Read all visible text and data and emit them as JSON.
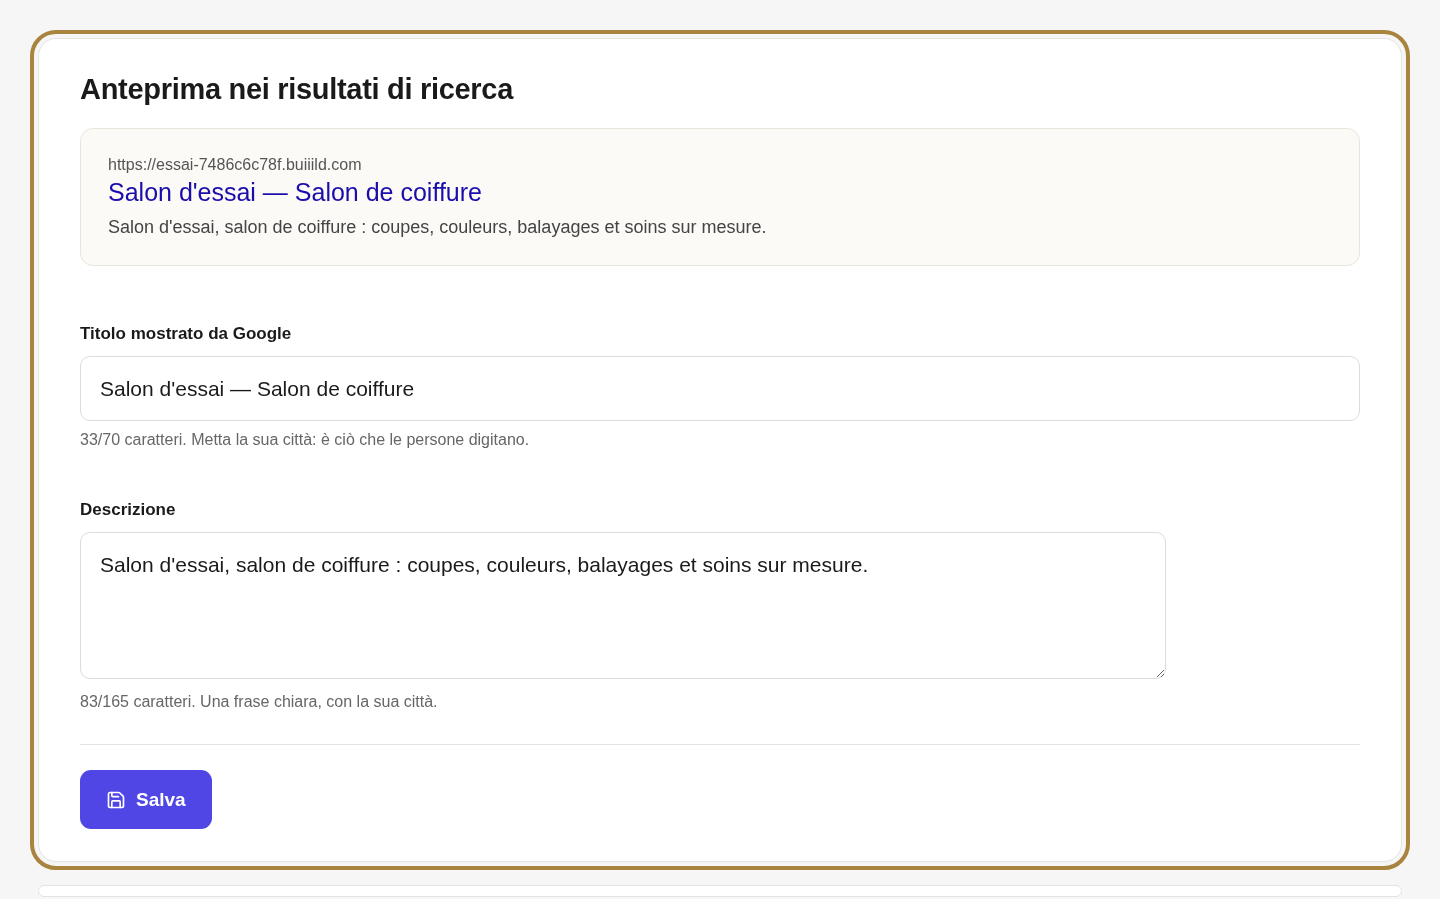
{
  "card": {
    "title": "Anteprima nei risultati di ricerca",
    "preview": {
      "url": "https://essai-7486c6c78f.buiiild.com",
      "title": "Salon d'essai — Salon de coiffure",
      "description": "Salon d'essai, salon de coiffure : coupes, couleurs, balayages et soins sur mesure."
    },
    "fields": [
      {
        "kind": "input",
        "label": "Titolo mostrato da Google",
        "value": "Salon d'essai — Salon de coiffure",
        "hint": "33/70 caratteri. Metta la sua città: è ciò che le persone digitano."
      },
      {
        "kind": "textarea",
        "label": "Descrizione",
        "value": "Salon d'essai, salon de coiffure : coupes, couleurs, balayages et soins sur mesure.",
        "hint": "83/165 caratteri. Una frase chiara, con la sua città."
      }
    ],
    "save_button": "Salva"
  }
}
